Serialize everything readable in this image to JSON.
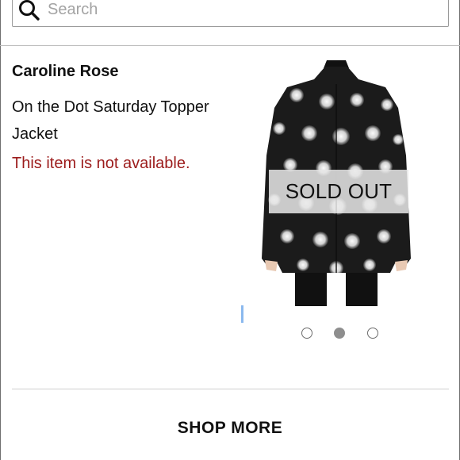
{
  "search": {
    "placeholder": "Search",
    "icon": "search-icon"
  },
  "product": {
    "brand": "Caroline Rose",
    "name": "On the Dot Saturday Topper Jacket",
    "availability": "This item is not available.",
    "image_overlay": "SOLD OUT",
    "image_subject": "black jacket with white dots, rear view"
  },
  "carousel": {
    "dot_count": 3,
    "active_index": 1
  },
  "footer": {
    "shop_more_label": "SHOP MORE"
  },
  "colors": {
    "availability_text": "#9c1c1c",
    "active_dot": "#8e8e8e",
    "jacket": "#1b1b1b",
    "polka_dot": "#f2f2f2"
  }
}
